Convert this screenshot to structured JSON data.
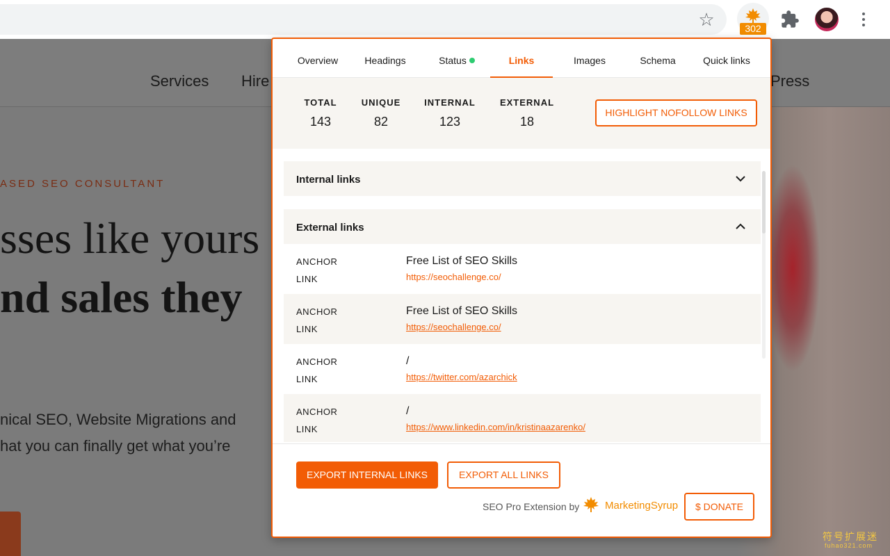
{
  "browser": {
    "extension_badge": "302"
  },
  "site": {
    "nav": [
      "Services",
      "Hire",
      "Press"
    ],
    "kicker": "ASED SEO CONSULTANT",
    "headline_1": "sses like yours g",
    "headline_2": "nd sales they",
    "para_1": "nical SEO, Website Migrations and",
    "para_2": "hat you can finally get what you’re"
  },
  "popup": {
    "tabs": [
      {
        "label": "Overview"
      },
      {
        "label": "Headings"
      },
      {
        "label": "Status"
      },
      {
        "label": "Links"
      },
      {
        "label": "Images"
      },
      {
        "label": "Schema"
      },
      {
        "label": "Quick links"
      }
    ],
    "active_tab": "Links",
    "stats": {
      "total_label": "TOTAL",
      "total_value": "143",
      "unique_label": "UNIQUE",
      "unique_value": "82",
      "internal_label": "INTERNAL",
      "internal_value": "123",
      "external_label": "EXTERNAL",
      "external_value": "18"
    },
    "highlight_button": "HIGHLIGHT NOFOLLOW LINKS",
    "internal_section": "Internal links",
    "external_section": "External links",
    "anchor_label": "ANCHOR",
    "link_label": "LINK",
    "external_links": [
      {
        "anchor": "Free List of SEO Skills",
        "url": "https://seochallenge.co/"
      },
      {
        "anchor": "Free List of SEO Skills",
        "url": "https://seochallenge.co/"
      },
      {
        "anchor": "/",
        "url": "https://twitter.com/azarchick"
      },
      {
        "anchor": "/",
        "url": "https://www.linkedin.com/in/kristinaazarenko/"
      }
    ],
    "export_internal": "EXPORT INTERNAL LINKS",
    "export_all": "EXPORT ALL LINKS",
    "by_text": "SEO Pro Extension by",
    "brand": "MarketingSyrup",
    "donate": "$ DONATE"
  },
  "watermark": {
    "cn": "符号扩展迷",
    "domain": "fuhao321.com"
  },
  "colors": {
    "accent": "#f25c05",
    "brand_orange": "#f28c00",
    "status_green": "#2ecc71"
  }
}
